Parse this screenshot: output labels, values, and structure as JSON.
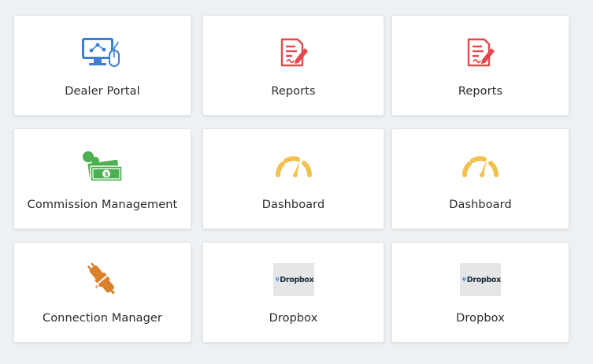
{
  "tiles": [
    {
      "label": "Dealer Portal",
      "icon": "dealer-portal-monitor-icon"
    },
    {
      "label": "Reports",
      "icon": "report-document-pen-icon"
    },
    {
      "label": "Reports",
      "icon": "report-document-pen-icon"
    },
    {
      "label": "Commission Management",
      "icon": "cash-money-icon"
    },
    {
      "label": "Dashboard",
      "icon": "gauge-speedometer-icon"
    },
    {
      "label": "Dashboard",
      "icon": "gauge-speedometer-icon"
    },
    {
      "label": "Connection Manager",
      "icon": "plug-connector-icon"
    },
    {
      "label": "Dropbox",
      "icon": "dropbox-logo-icon",
      "logo_text": "Dropbox"
    },
    {
      "label": "Dropbox",
      "icon": "dropbox-logo-icon",
      "logo_text": "Dropbox"
    }
  ],
  "colors": {
    "background": "#eef1f4",
    "tile": "#ffffff",
    "blue_icon": "#3d7fd6",
    "red_icon": "#e5484d",
    "green_icon": "#4caf50",
    "yellow_icon": "#f2c14e",
    "orange_icon": "#d9822b",
    "dropbox_blue": "#0061ff"
  }
}
